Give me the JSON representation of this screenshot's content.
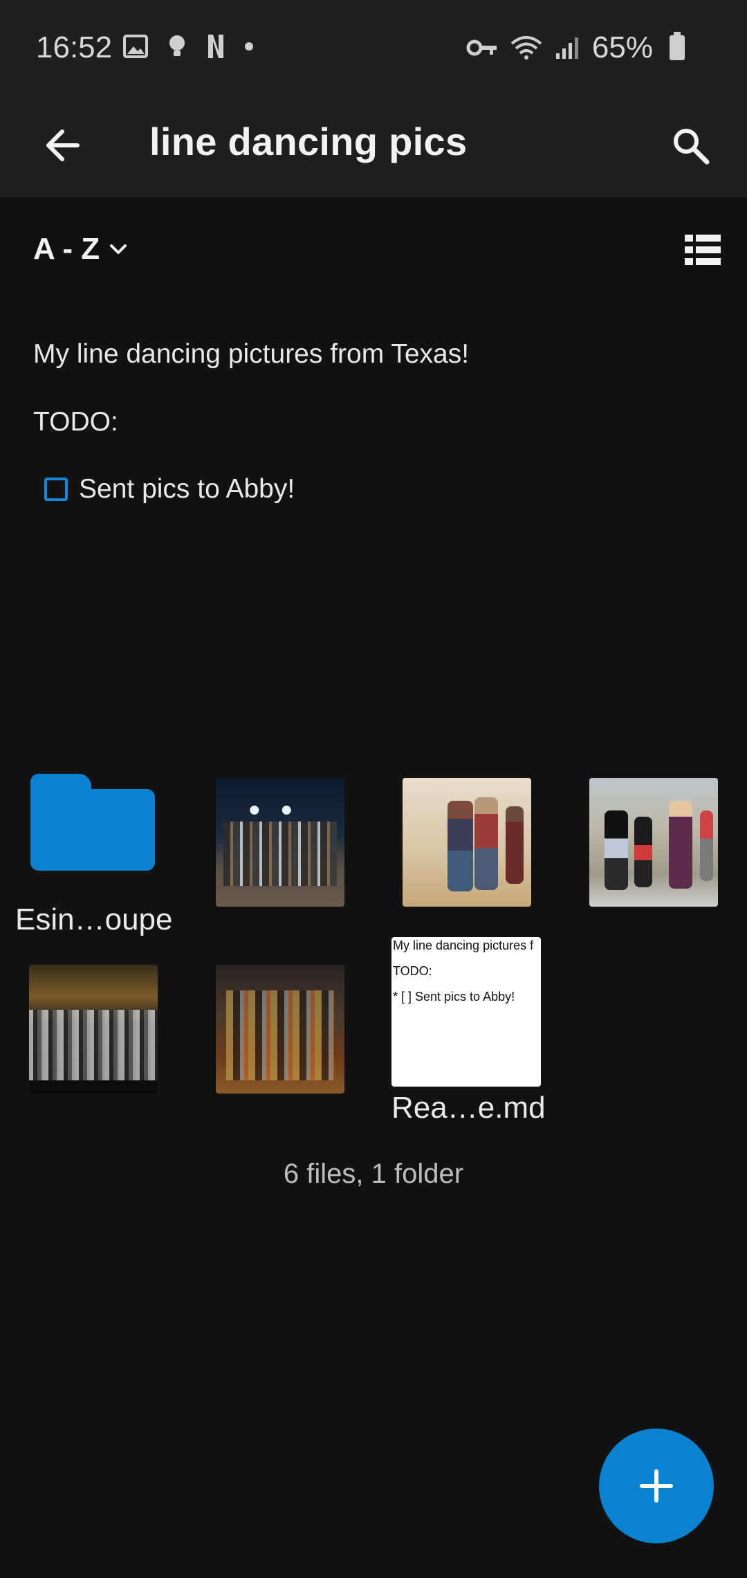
{
  "status_bar": {
    "time": "16:52",
    "battery": "65%"
  },
  "app_bar": {
    "title": "line dancing pics",
    "back_icon": "arrow-left-icon",
    "search_icon": "search-icon"
  },
  "sort": {
    "label": "A - Z",
    "view_icon": "list-view-icon"
  },
  "readme": {
    "line1": "My line dancing pictures from Texas!",
    "line2": "TODO:",
    "todo_item": "Sent pics to Abby!"
  },
  "files": {
    "folder_name": "Esin…oupe",
    "document_name": "Rea…e.md",
    "document_preview": {
      "line1": "My line dancing pictures f",
      "line2": "TODO:",
      "line3": "* [ ] Sent pics to Abby!"
    }
  },
  "summary": "6 files, 1 folder",
  "colors": {
    "accent": "#0a82d0",
    "background": "#121212",
    "toolbar": "#1f1f1f"
  },
  "fab_icon": "plus-icon"
}
